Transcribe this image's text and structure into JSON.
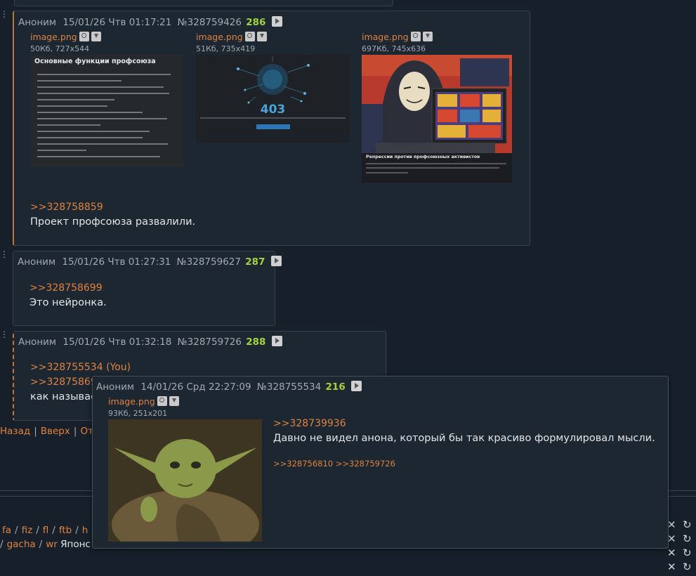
{
  "post1": {
    "author": "Аноним",
    "datetime": "15/01/26 Чтв 01:17:21",
    "id": "№328759426",
    "number": "286",
    "files": [
      {
        "name": "image.png",
        "meta": "50Кб, 727x544"
      },
      {
        "name": "image.png",
        "meta": "51Кб, 735x419"
      },
      {
        "name": "image.png",
        "meta": "697Кб, 745x636"
      }
    ],
    "thumb1": {
      "title": "Основные функции профсоюза",
      "bullets": [
        "Координирование совместных действий работников ИТ для отстаивания их интересов. Планирование и ведение кампаний.",
        "Юридическая защита членов профсоюза в случае конфликтов с работодателем.",
        "Противостояние необоснованным сокращениям. Борьба за достойные компенсации при сокращениях.",
        "Ведение рейтинга работодателей.",
        "Отстаивание интересов работников ИТ в органах власти.",
        "Обучение практике ведения профессиональных споров и управлению ими.",
        "Просвещение и агитация.",
        "Помощь в повышении квалификации для членов профсоюза.",
        "Помощь в поиске работы для увольняющихся/уволенных.",
        "Координация усилий совместно с другими российскими и зарубежными профсоюзами.",
        "Взаимопомощь. Сбор забастовочного фонда и другие фонды помощи."
      ]
    },
    "thumb2": {
      "code": "403",
      "button": "Вернуться на главную"
    },
    "thumb3": {
      "caption": "Репрессии против профсоюзных активистов"
    },
    "reply": ">>328758859",
    "text": "Проект профсоюза развалили."
  },
  "post2": {
    "author": "Аноним",
    "datetime": "15/01/26 Чтв 01:27:31",
    "id": "№328759627",
    "number": "287",
    "reply": ">>328758699",
    "text": "Это нейронка."
  },
  "post3": {
    "author": "Аноним",
    "datetime": "15/01/26 Чтв 01:32:18",
    "id": "№328759726",
    "number": "288",
    "reply1": ">>328755534 (You)",
    "reply2": ">>32875869",
    "text": "как называе"
  },
  "nav": {
    "back": "Назад",
    "top": "Вверх",
    "other": "Отп"
  },
  "boards": {
    "row1": [
      "fa",
      "fiz",
      "fl",
      "ftb",
      "h"
    ],
    "row2": [
      "gacha",
      "wr"
    ],
    "row2_tail": "Японс"
  },
  "popup": {
    "author": "Аноним",
    "datetime": "14/01/26 Срд 22:27:09",
    "id": "№328755534",
    "number": "216",
    "file": {
      "name": "image.png",
      "meta": "93Кб, 251x201"
    },
    "reply": ">>328739936",
    "text": "Давно не видел анона, который бы так красиво формулировал мысли.",
    "backlinks": [
      ">>328756810",
      ">>328759726"
    ]
  },
  "colors": {
    "accent": "#e0823f",
    "post_number": "#a6d23a",
    "background": "#17202a"
  }
}
